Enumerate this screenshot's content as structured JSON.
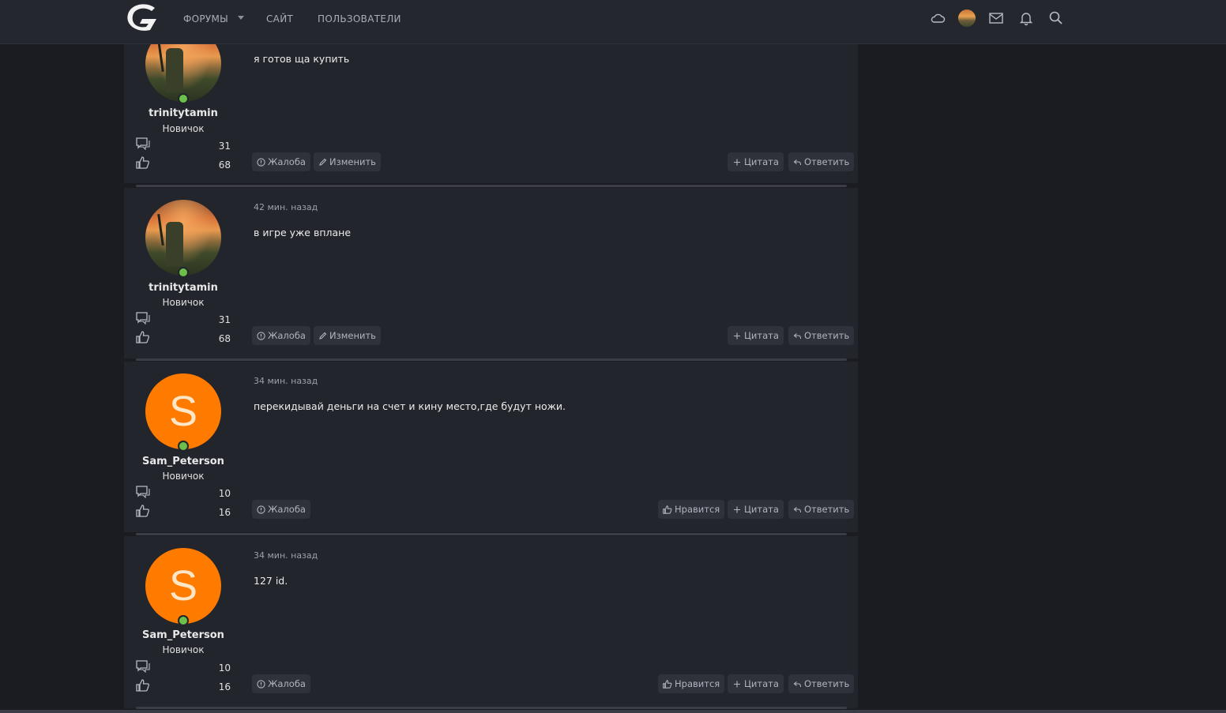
{
  "nav": {
    "items": [
      "ФОРУМЫ",
      "САЙТ",
      "ПОЛЬЗОВАТЕЛИ"
    ],
    "icons": [
      "cloud-icon",
      "avatar",
      "mail-icon",
      "bell-icon",
      "search-icon"
    ]
  },
  "actions": {
    "report": "Жалоба",
    "edit": "Изменить",
    "like": "Нравится",
    "quote": "Цитата",
    "reply": "Ответить"
  },
  "posts": [
    {
      "author": "trinitytamin",
      "title": "Новичок",
      "messages": "31",
      "reactions": "68",
      "date": "",
      "text": "я готов ща купить",
      "avatar_type": "photo"
    },
    {
      "author": "trinitytamin",
      "title": "Новичок",
      "messages": "31",
      "reactions": "68",
      "date": "42 мин. назад",
      "text": "в игре уже вплане",
      "avatar_type": "photo"
    },
    {
      "author": "Sam_Peterson",
      "title": "Новичок",
      "messages": "10",
      "reactions": "16",
      "date": "34 мин. назад",
      "text": "перекидывай деньги на счет и кину место,где будут ножи.",
      "avatar_type": "letter",
      "avatar_letter": "S"
    },
    {
      "author": "Sam_Peterson",
      "title": "Новичок",
      "messages": "10",
      "reactions": "16",
      "date": "34 мин. назад",
      "text": "127 id.",
      "avatar_type": "letter",
      "avatar_letter": "S"
    }
  ],
  "colors": {
    "background": "#1b1c22",
    "post_bg": "#23252c",
    "button_bg": "#2f323a",
    "online": "#6cc04a",
    "letter_avatar": "#ff7b00"
  }
}
